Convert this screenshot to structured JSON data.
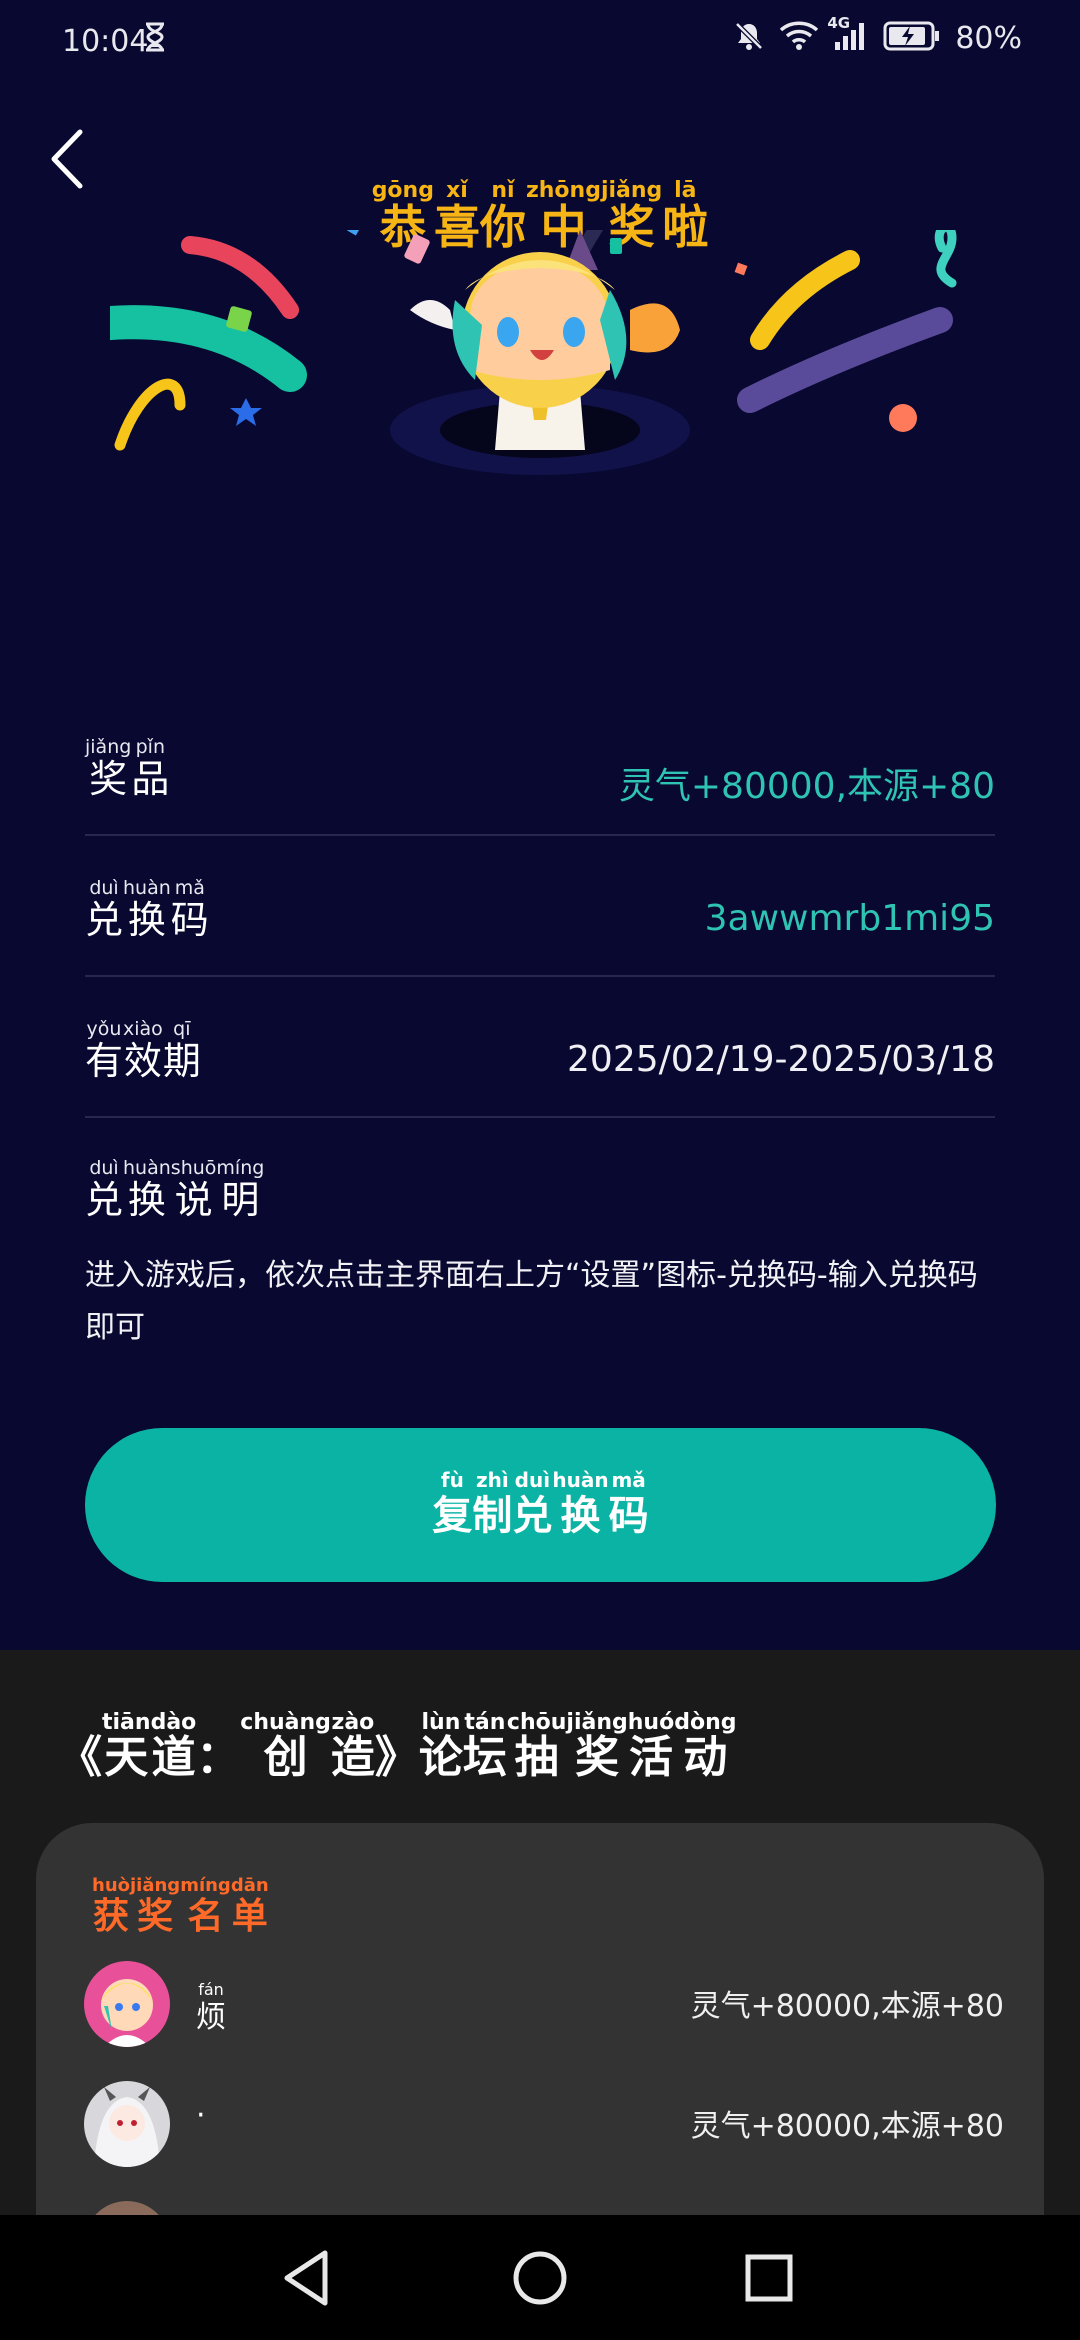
{
  "status_bar": {
    "time": "10:04",
    "battery": "80%",
    "network": "4G"
  },
  "header": {
    "title_chars": [
      {
        "py": "gōng",
        "hz": "恭"
      },
      {
        "py": "xǐ",
        "hz": "喜"
      },
      {
        "py": "nǐ",
        "hz": "你"
      },
      {
        "py": "zhōng",
        "hz": "中"
      },
      {
        "py": "jiǎng",
        "hz": "奖"
      },
      {
        "py": "lā",
        "hz": "啦"
      }
    ]
  },
  "prize_info": {
    "prize_label_py": [
      "jiǎng",
      "pǐn"
    ],
    "prize_label": [
      "奖",
      "品"
    ],
    "prize_value": "灵气+80000,本源+80",
    "code_label_py": [
      "duì",
      "huàn",
      "mǎ"
    ],
    "code_label": [
      "兑",
      "换",
      "码"
    ],
    "code_value": "3awwmrb1mi95",
    "validity_label_py": [
      "yǒu",
      "xiào",
      "qī"
    ],
    "validity_label": [
      "有",
      "效",
      "期"
    ],
    "validity_value": "2025/02/19-2025/03/18",
    "instructions_label_py": [
      "duì",
      "huàn",
      "shuō",
      "míng"
    ],
    "instructions_label": [
      "兑",
      "换",
      "说",
      "明"
    ],
    "instructions_text": "进入游戏后，依次点击主界面右上方“设置”图标-兑换码-输入兑换码即可"
  },
  "copy_button": {
    "py": [
      "fù",
      "zhì",
      "duì",
      "huàn",
      "mǎ"
    ],
    "hz": [
      "复",
      "制",
      "兑",
      "换",
      "码"
    ]
  },
  "event": {
    "title_chars": [
      {
        "py": "",
        "hz": "《"
      },
      {
        "py": "tiān",
        "hz": "天"
      },
      {
        "py": "dào",
        "hz": "道"
      },
      {
        "py": "",
        "hz": "："
      },
      {
        "py": "chuàng",
        "hz": "创"
      },
      {
        "py": "zào",
        "hz": "造"
      },
      {
        "py": "",
        "hz": "》"
      },
      {
        "py": "lùn",
        "hz": "论"
      },
      {
        "py": "tán",
        "hz": "坛"
      },
      {
        "py": "chōu",
        "hz": "抽"
      },
      {
        "py": "jiǎng",
        "hz": "奖"
      },
      {
        "py": "huó",
        "hz": "活"
      },
      {
        "py": "dòng",
        "hz": "动"
      }
    ],
    "winners_title_py": [
      "huò",
      "jiǎng",
      "míng",
      "dān"
    ],
    "winners_title": [
      "获",
      "奖",
      "名",
      "单"
    ],
    "winners": [
      {
        "name_py": "fán",
        "name": "烦",
        "prize": "灵气+80000,本源+80"
      },
      {
        "name_py": "",
        "name": "·",
        "prize": "灵气+80000,本源+80"
      }
    ]
  },
  "colors": {
    "background": "#080830",
    "accent_teal": "#0bb3a4",
    "title_gold": "#f7b515",
    "winners_orange": "#ff6a28"
  }
}
